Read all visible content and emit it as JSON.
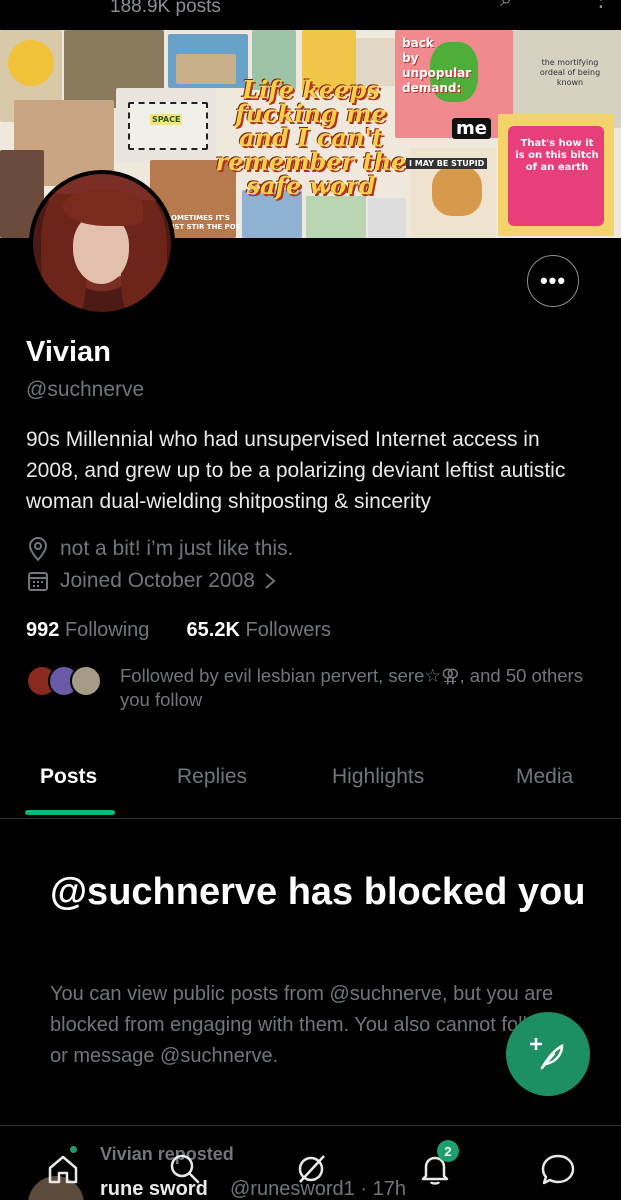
{
  "header": {
    "post_count": "188.9K posts"
  },
  "banner": {
    "main_text": [
      "Life keeps",
      "fucking me",
      "and I can't",
      "remember the",
      "safe word"
    ],
    "sticker_back_by": [
      "back",
      "by",
      "unpopular",
      "demand:"
    ],
    "sticker_me": "me",
    "sticker_space": "SPACE",
    "sticker_stupid": "I MAY BE STUPID",
    "sticker_thats_how": [
      "That's how it",
      "is on this bitch",
      "of an earth"
    ],
    "sticker_mortifying": [
      "the mortifying",
      "ordeal of being",
      "known"
    ],
    "sticker_sometimes": [
      "SOMETIMES IT'S",
      "JUST STIR THE POT"
    ]
  },
  "profile": {
    "name": "Vivian",
    "handle": "@suchnerve",
    "bio": "90s Millennial who had unsupervised Internet access in 2008, and grew up to be a polarizing deviant leftist autistic woman dual-wielding shitposting & sincerity",
    "location": "not a bit! i’m just like this.",
    "joined": "Joined October 2008",
    "following_count": "992",
    "following_label": "Following",
    "followers_count": "65.2K",
    "followers_label": "Followers",
    "followed_by": "Followed by evil lesbian pervert, sere☆⚢, and 50 others you follow"
  },
  "tabs": [
    "Posts",
    "Replies",
    "Highlights",
    "Media"
  ],
  "blocked": {
    "title": "@suchnerve has blocked you",
    "description": "You can view public posts from @suchnerve, but you are blocked from engaging with them. You also cannot follow or message @suchnerve."
  },
  "peek_post": {
    "repost_label": "Vivian reposted",
    "author_name": "rune sword",
    "author_handle": "@runesword1 · 17h"
  },
  "nav": {
    "notifications_badge": "2"
  },
  "colors": {
    "accent": "#00ba7c",
    "fab": "#1d8f63",
    "muted": "#71767b"
  }
}
